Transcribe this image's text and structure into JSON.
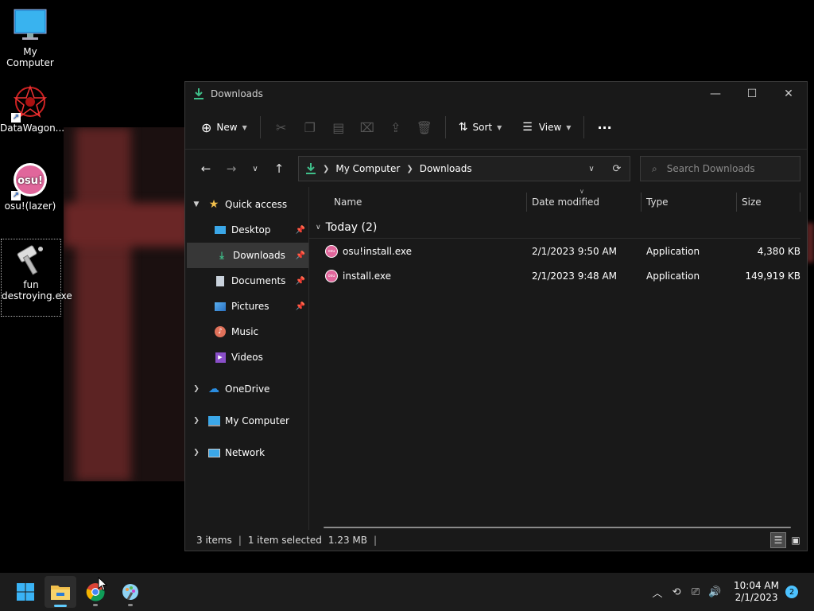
{
  "desktop": {
    "icons": [
      {
        "label": "My Computer"
      },
      {
        "label": "DataWagon..."
      },
      {
        "label": "osu!(lazer)"
      },
      {
        "label": "fun destroying.exe"
      }
    ]
  },
  "window": {
    "title": "Downloads",
    "controls": {
      "minimize": "—",
      "maximize": "☐",
      "close": "✕"
    }
  },
  "toolbar": {
    "new_label": "New",
    "sort_label": "Sort",
    "view_label": "View",
    "more_label": "···"
  },
  "address": {
    "crumbs": [
      "My Computer",
      "Downloads"
    ],
    "search_placeholder": "Search Downloads"
  },
  "sidebar": {
    "quick_access": "Quick access",
    "items": [
      {
        "label": "Desktop",
        "pinned": true
      },
      {
        "label": "Downloads",
        "pinned": true,
        "selected": true
      },
      {
        "label": "Documents",
        "pinned": true
      },
      {
        "label": "Pictures",
        "pinned": true
      },
      {
        "label": "Music"
      },
      {
        "label": "Videos"
      }
    ],
    "roots": [
      "OneDrive",
      "My Computer",
      "Network"
    ]
  },
  "columns": {
    "name": "Name",
    "date": "Date modified",
    "type": "Type",
    "size": "Size"
  },
  "group": {
    "label": "Today (2)"
  },
  "files": [
    {
      "name": "osu!install.exe",
      "date": "2/1/2023 9:50 AM",
      "type": "Application",
      "size": "4,380 KB"
    },
    {
      "name": "install.exe",
      "date": "2/1/2023 9:48 AM",
      "type": "Application",
      "size": "149,919 KB"
    }
  ],
  "status": {
    "items": "3 items",
    "selected": "1 item selected",
    "size": "1.23 MB"
  },
  "taskbar": {
    "time": "10:04 AM",
    "date": "2/1/2023",
    "notifications": "2"
  },
  "colors": {
    "accent": "#60cdff",
    "osu": "#e0669b",
    "folder": "#f2c04c"
  }
}
